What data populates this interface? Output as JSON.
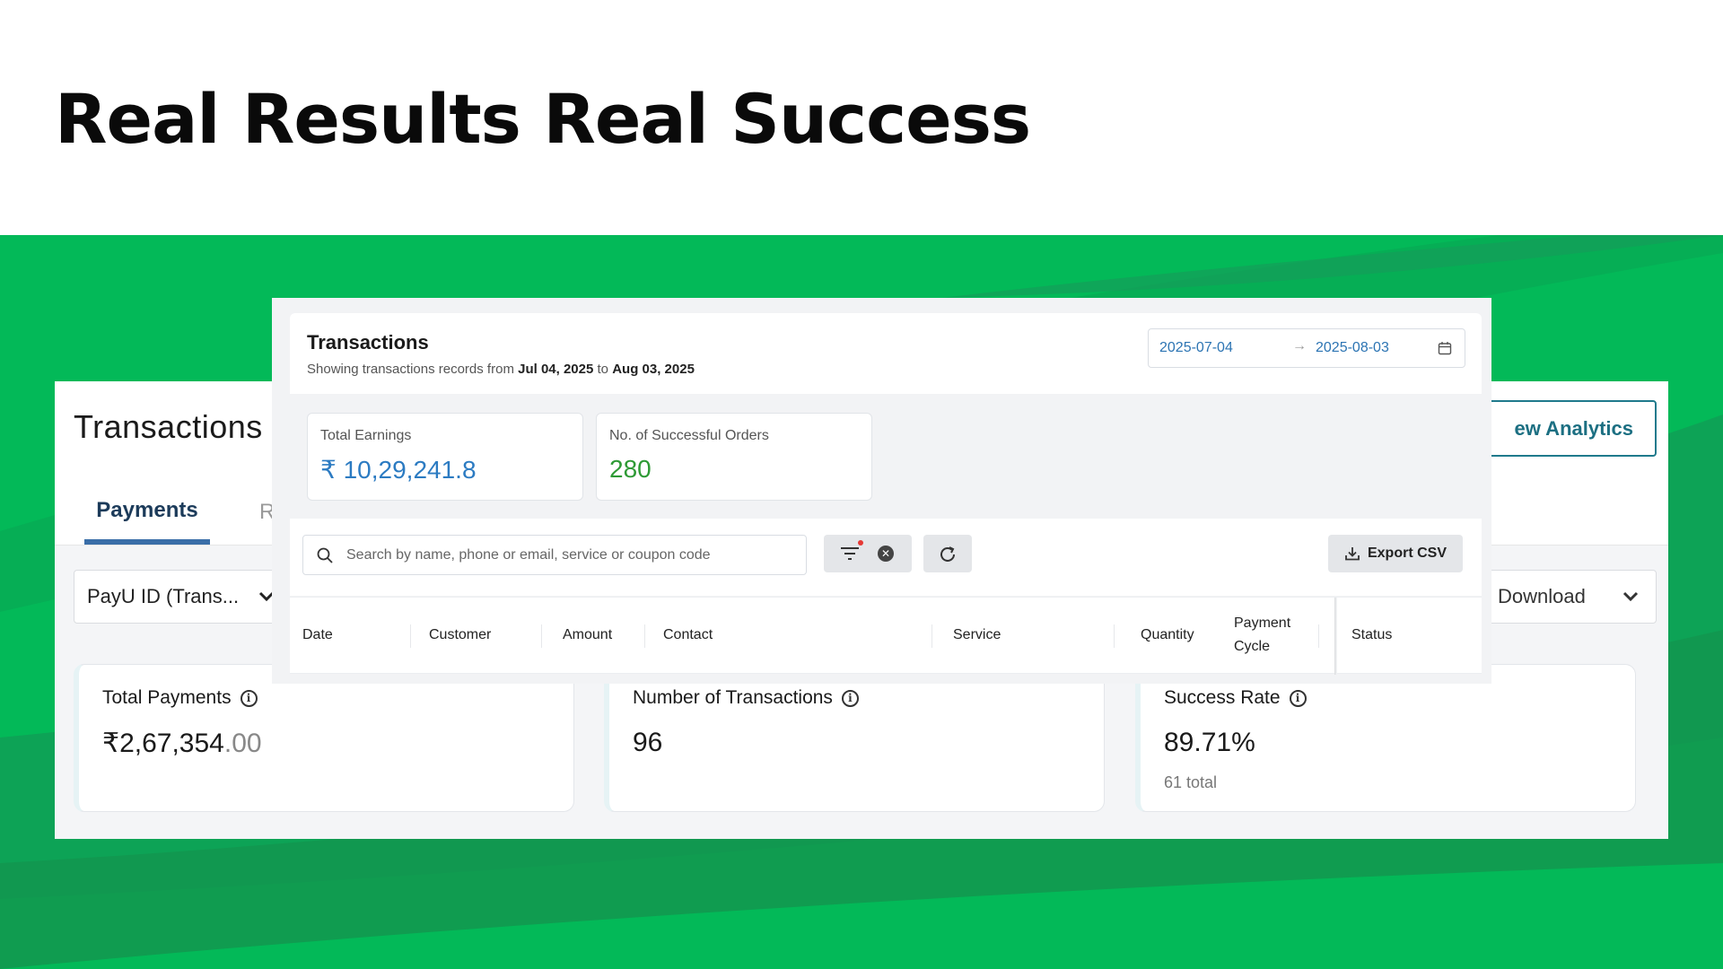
{
  "headline": "Real Results Real Success",
  "back_panel": {
    "title": "Transactions",
    "analytics_button": "ew Analytics",
    "tab_active": "Payments",
    "tab_next": "R",
    "select_value": "PayU ID (Trans...",
    "download_button": "Download",
    "cards": [
      {
        "label": "Total Payments",
        "value_main": "₹2,67,354",
        "value_dec": ".00",
        "sub": ""
      },
      {
        "label": "Number of Transactions",
        "value_main": "96",
        "value_dec": "",
        "sub": ""
      },
      {
        "label": "Success Rate",
        "value_main": "89.71%",
        "value_dec": "",
        "sub": "61 total"
      }
    ]
  },
  "front_panel": {
    "title": "Transactions",
    "subtitle_prefix": "Showing transactions records from ",
    "subtitle_from": "Jul 04, 2025",
    "subtitle_mid": " to ",
    "subtitle_to": "Aug 03, 2025",
    "date_start": "2025-07-04",
    "date_arrow": "→",
    "date_end": "2025-08-03",
    "kpis": [
      {
        "label": "Total Earnings",
        "value": "₹ 10,29,241.8",
        "color": "#2c7bc2"
      },
      {
        "label": "No. of Successful Orders",
        "value": "280",
        "color": "#2e9a35"
      }
    ],
    "search_placeholder": "Search by name, phone or email, service or coupon code",
    "export_label": "Export CSV",
    "columns": [
      "Date",
      "Customer",
      "Amount",
      "Contact",
      "Service",
      "Quantity",
      "Payment",
      "Cycle",
      "Status"
    ]
  },
  "colors": {
    "green": "#03b958",
    "accent_teal": "#1c6f82",
    "tab_blue": "#3a6ea8"
  }
}
